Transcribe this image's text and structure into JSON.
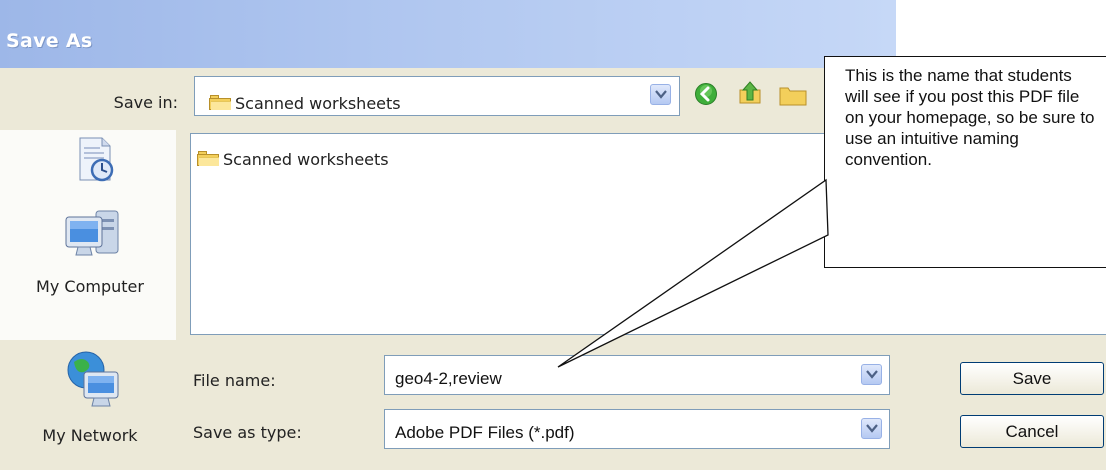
{
  "window": {
    "title": "Save As"
  },
  "save_in": {
    "label": "Save in:",
    "value": "Scanned worksheets"
  },
  "toolbar": {
    "icons": [
      "back-icon",
      "up-folder-icon",
      "new-folder-icon"
    ]
  },
  "places": [
    {
      "label": "",
      "icon": "recent-documents-icon"
    },
    {
      "label": "My Computer",
      "icon": "my-computer-icon"
    },
    {
      "label": "My Network",
      "icon": "my-network-icon"
    }
  ],
  "file_list": {
    "items": [
      "Scanned worksheets"
    ]
  },
  "file_name": {
    "label": "File name:",
    "value": "geo4-2,review"
  },
  "save_as_type": {
    "label": "Save as type:",
    "value": "Adobe PDF Files (*.pdf)"
  },
  "buttons": {
    "save": "Save",
    "cancel": "Cancel"
  },
  "callout": {
    "text": "This is the name that students will see if you post this PDF file on your homepage, so be sure to use an intuitive naming convention."
  },
  "colors": {
    "title_bar": "#aec5ef",
    "dialog_bg": "#ece9d8",
    "field_border": "#7f9db9"
  }
}
